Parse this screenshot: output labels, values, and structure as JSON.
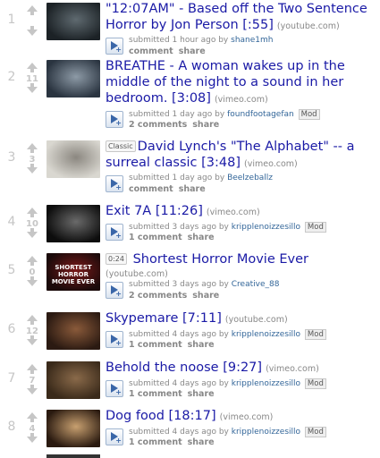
{
  "posts": [
    {
      "rank": "1",
      "score": "",
      "tag": "",
      "title": "\"12:07AM\" - Based off the Two Sentence Horror by Jon Person [:55]",
      "domain": "(youtube.com)",
      "submitted": "submitted 1 hour ago by",
      "author": "shane1mh",
      "mod": "",
      "comments": "comment",
      "share": "share",
      "thumb_colors": [
        "#1c2226",
        "#5f6a70"
      ]
    },
    {
      "rank": "2",
      "score": "11",
      "tag": "",
      "title": "BREATHE - A woman wakes up in the middle of the night to a sound in her bedroom. [3:08]",
      "domain": "(vimeo.com)",
      "submitted": "submitted 1 day ago by",
      "author": "foundfootagefan",
      "mod": "Mod",
      "comments": "2 comments",
      "share": "share",
      "thumb_colors": [
        "#2a3440",
        "#8d9aa6"
      ]
    },
    {
      "rank": "3",
      "score": "3",
      "tag": "Classic",
      "title": "David Lynch's \"The Alphabet\" -- a surreal classic [3:48]",
      "domain": "(vimeo.com)",
      "submitted": "submitted 1 day ago by",
      "author": "Beelzeballz",
      "mod": "",
      "comments": "comment",
      "share": "share",
      "thumb_colors": [
        "#d9d7d0",
        "#8b8780"
      ]
    },
    {
      "rank": "4",
      "score": "10",
      "tag": "",
      "title": "Exit 7A [11:26]",
      "domain": "(vimeo.com)",
      "submitted": "submitted 3 days ago by",
      "author": "kripplenoizzesillo",
      "mod": "Mod",
      "comments": "1 comment",
      "share": "share",
      "thumb_colors": [
        "#0d0d0d",
        "#6a6a6a"
      ]
    },
    {
      "rank": "5",
      "score": "0",
      "tag": "0:24",
      "title": "Shortest Horror Movie Ever",
      "domain": "(youtube.com)",
      "submitted": "submitted 3 days ago by",
      "author": "Creative_88",
      "mod": "",
      "comments": "2 comments",
      "share": "share",
      "thumb_colors": [
        "#1a0a0a",
        "#7a1a1a"
      ]
    },
    {
      "rank": "6",
      "score": "12",
      "tag": "",
      "title": "Skypemare [7:11]",
      "domain": "(youtube.com)",
      "submitted": "submitted 4 days ago by",
      "author": "kripplenoizzesillo",
      "mod": "Mod",
      "comments": "1 comment",
      "share": "share",
      "thumb_colors": [
        "#2b1a12",
        "#8a5a3a"
      ]
    },
    {
      "rank": "7",
      "score": "7",
      "tag": "",
      "title": "Behold the noose [9:27]",
      "domain": "(vimeo.com)",
      "submitted": "submitted 4 days ago by",
      "author": "kripplenoizzesillo",
      "mod": "Mod",
      "comments": "1 comment",
      "share": "share",
      "thumb_colors": [
        "#3a2a1a",
        "#8a6a4a"
      ]
    },
    {
      "rank": "8",
      "score": "4",
      "tag": "",
      "title": "Dog food [18:17]",
      "domain": "(vimeo.com)",
      "submitted": "submitted 4 days ago by",
      "author": "kripplenoizzesillo",
      "mod": "Mod",
      "comments": "1 comment",
      "share": "share",
      "thumb_colors": [
        "#2a1a10",
        "#c8a070"
      ]
    }
  ],
  "thumb5_text": "SHORTEST HORROR MOVIE EVER"
}
